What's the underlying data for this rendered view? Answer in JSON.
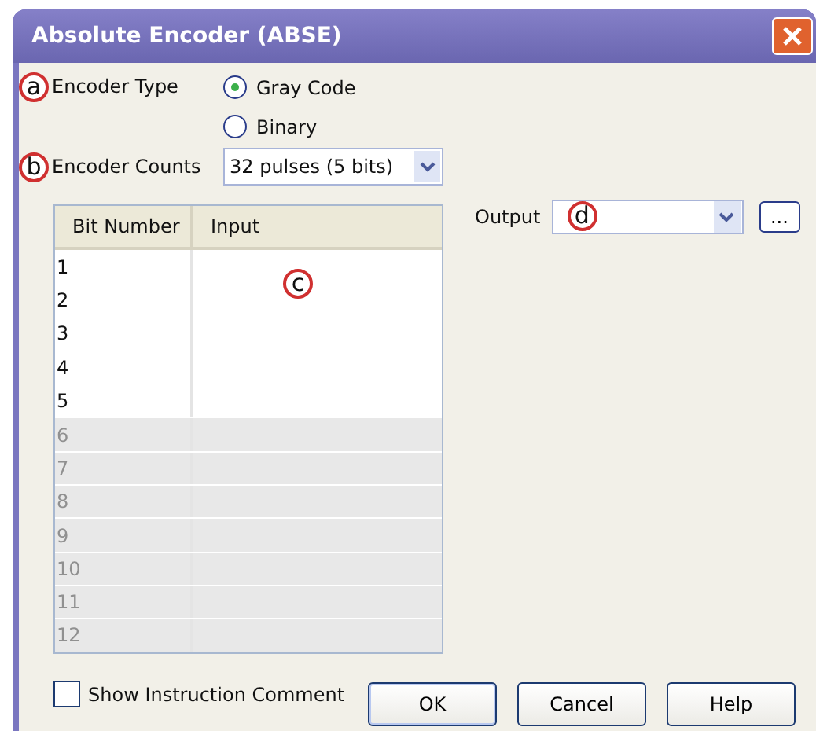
{
  "window": {
    "title": "Absolute Encoder (ABSE)"
  },
  "encoder_type": {
    "callout": "a",
    "label": "Encoder Type",
    "options": [
      {
        "label": "Gray Code",
        "selected": true
      },
      {
        "label": "Binary",
        "selected": false
      }
    ]
  },
  "encoder_counts": {
    "callout": "b",
    "label": "Encoder Counts",
    "value": "32 pulses (5 bits)"
  },
  "table": {
    "callout": "c",
    "columns": [
      "Bit Number",
      "Input"
    ],
    "rows": [
      {
        "bit": "1",
        "disabled": false
      },
      {
        "bit": "2",
        "disabled": false
      },
      {
        "bit": "3",
        "disabled": false
      },
      {
        "bit": "4",
        "disabled": false
      },
      {
        "bit": "5",
        "disabled": false
      },
      {
        "bit": "6",
        "disabled": true
      },
      {
        "bit": "7",
        "disabled": true
      },
      {
        "bit": "8",
        "disabled": true
      },
      {
        "bit": "9",
        "disabled": true
      },
      {
        "bit": "10",
        "disabled": true
      },
      {
        "bit": "11",
        "disabled": true
      },
      {
        "bit": "12",
        "disabled": true
      }
    ]
  },
  "output": {
    "label": "Output",
    "callout": "d",
    "browse": "..."
  },
  "show_comment": {
    "label": "Show Instruction Comment",
    "checked": false
  },
  "buttons": [
    "OK",
    "Cancel",
    "Help"
  ]
}
